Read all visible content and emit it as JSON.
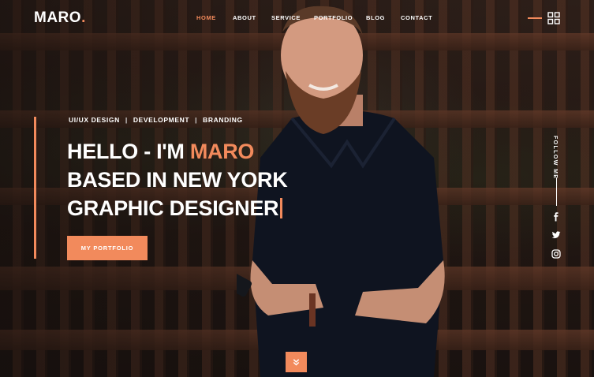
{
  "brand": {
    "name": "MARO",
    "dot": "."
  },
  "nav": {
    "items": [
      {
        "label": "HOME",
        "active": true
      },
      {
        "label": "ABOUT",
        "active": false
      },
      {
        "label": "SERVICE",
        "active": false
      },
      {
        "label": "PORTFOLIO",
        "active": false
      },
      {
        "label": "BLOG",
        "active": false
      },
      {
        "label": "CONTACT",
        "active": false
      }
    ]
  },
  "hero": {
    "skills": [
      "UI/UX DESIGN",
      "DEVELOPMENT",
      "BRANDING"
    ],
    "separator": "|",
    "line1_prefix": "HELLO - I'M ",
    "line1_name": "MARO",
    "line2": "BASED IN NEW YORK",
    "line3": "GRAPHIC DESIGNER",
    "cta_label": "MY PORTFOLIO"
  },
  "social": {
    "follow_label": "FOLLOW ME",
    "icons": [
      "facebook-icon",
      "twitter-icon",
      "instagram-icon"
    ]
  },
  "colors": {
    "accent": "#f28a5c",
    "text": "#ffffff"
  }
}
